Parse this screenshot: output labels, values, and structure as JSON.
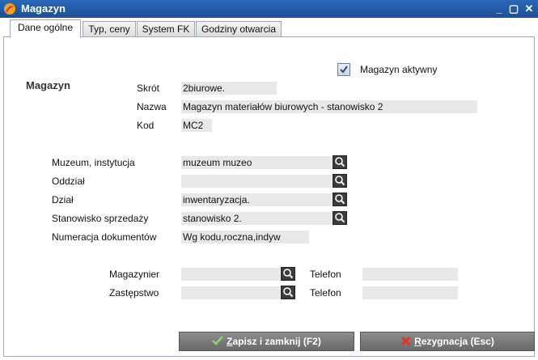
{
  "window": {
    "title": "Magazyn",
    "controls": {
      "minimize": "_",
      "restore": "▢",
      "close": "✕"
    }
  },
  "tabs": [
    {
      "label": "Dane ogólne",
      "active": true
    },
    {
      "label": "Typ, ceny",
      "active": false
    },
    {
      "label": "System FK",
      "active": false
    },
    {
      "label": "Godziny otwarcia",
      "active": false
    }
  ],
  "active_checkbox": {
    "label": "Magazyn aktywny",
    "checked": true
  },
  "magazyn": {
    "section_label": "Magazyn",
    "skrot_label": "Skrót",
    "skrot_value": "2biurowe.",
    "nazwa_label": "Nazwa",
    "nazwa_value": "Magazyn materiałów biurowych - stanowisko 2",
    "kod_label": "Kod",
    "kod_value": "MC2"
  },
  "fields": {
    "muzeum_label": "Muzeum, instytucja",
    "muzeum_value": "muzeum muzeo",
    "oddzial_label": "Oddział",
    "oddzial_value": "",
    "dzial_label": "Dział",
    "dzial_value": "inwentaryzacja.",
    "stanowisko_label": "Stanowisko sprzedaży",
    "stanowisko_value": "stanowisko 2.",
    "numeracja_label": "Numeracja dokumentów",
    "numeracja_value": "Wg kodu,roczna,indyw"
  },
  "staff": {
    "magazynier_label": "Magazynier",
    "magazynier_value": "",
    "telefon1_label": "Telefon",
    "telefon1_value": "",
    "zastepstwo_label": "Zastępstwo",
    "zastepstwo_value": "",
    "telefon2_label": "Telefon",
    "telefon2_value": ""
  },
  "buttons": {
    "save_key": "Z",
    "save_rest": "apisz i zamknij (F2)",
    "cancel_key": "R",
    "cancel_rest": "ezygnacja (Esc)"
  },
  "colors": {
    "titlebar": "#1c4f97",
    "field_bg": "#e8e8e8",
    "button_bg": "#7a7a7a"
  }
}
